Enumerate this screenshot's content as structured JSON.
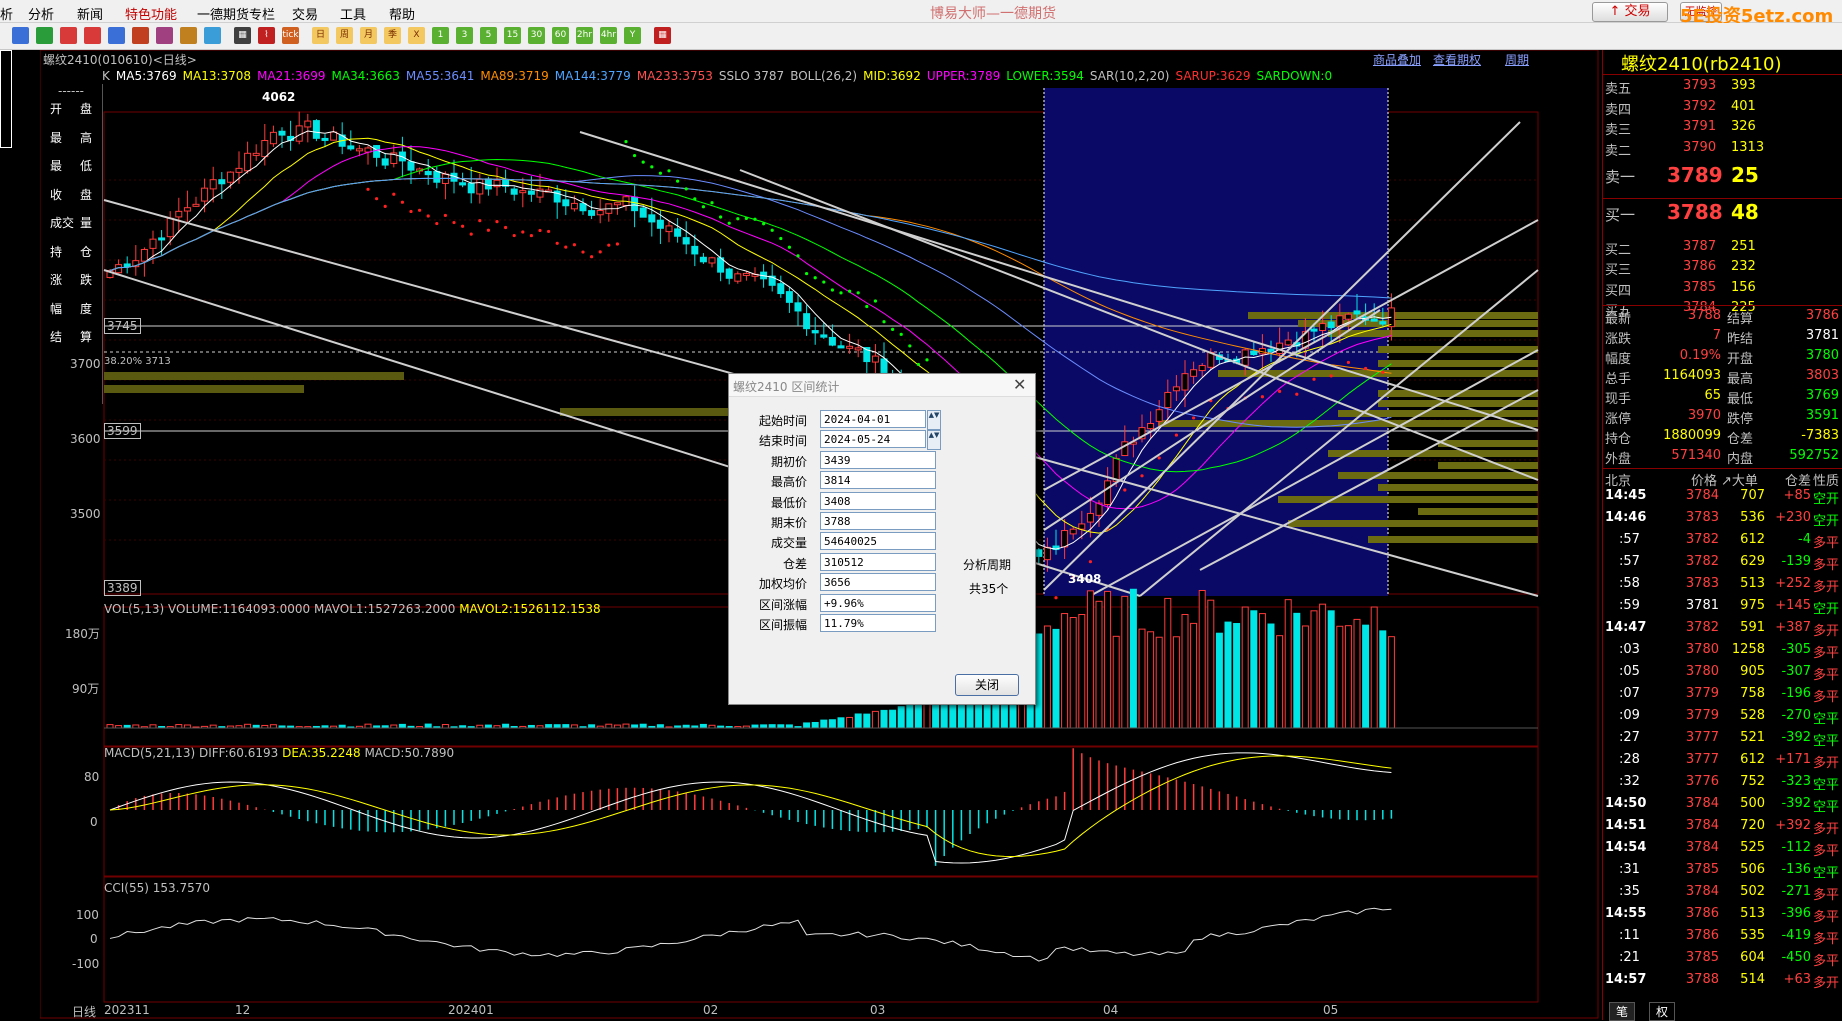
{
  "menu": {
    "items": [
      "析",
      "分析",
      "新闻",
      "特色功能",
      "一德期货专栏",
      "交易",
      "工具",
      "帮助"
    ],
    "app_title": "博易大师—一德期货",
    "trade_button": "交易",
    "stop_button": "无监控",
    "watermark": "5E投资5etz.com"
  },
  "toolbar": {
    "icons": [
      "window-icon",
      "refresh-icon",
      "zoom-in-icon",
      "zoom-out-icon",
      "search-icon",
      "pen-icon",
      "eraser-icon",
      "filter-icon",
      "new-icon",
      "table-icon",
      "chart-icon",
      "tick-icon",
      "day-icon",
      "week-icon",
      "month-icon",
      "season-icon",
      "year-icon",
      "1min-icon",
      "3min-icon",
      "5min-icon",
      "15min-icon",
      "30min-icon",
      "60min-icon",
      "2hr-icon",
      "4hr-icon",
      "y-icon",
      "calc-icon"
    ],
    "labels": [
      "tick",
      "日",
      "周",
      "月",
      "季",
      "X",
      "1",
      "3",
      "5",
      "15",
      "30",
      "60",
      "2hr",
      "4hr",
      "Y"
    ]
  },
  "chart": {
    "title": "螺纹2410(010610)<日线>",
    "top_links": [
      "商品叠加",
      "查看期权",
      "周期"
    ],
    "k_indicators": [
      {
        "text": "K",
        "color": "#c0c0c0"
      },
      {
        "text": "MA5:3769",
        "color": "#ffffff"
      },
      {
        "text": "MA13:3708",
        "color": "#ffff00"
      },
      {
        "text": "MA21:3699",
        "color": "#ff00ff"
      },
      {
        "text": "MA34:3663",
        "color": "#00ff00"
      },
      {
        "text": "MA55:3641",
        "color": "#6a8cff"
      },
      {
        "text": "MA89:3719",
        "color": "#ff8c00"
      },
      {
        "text": "MA144:3779",
        "color": "#4fa4ff"
      },
      {
        "text": "MA233:3753",
        "color": "#ff5050"
      },
      {
        "text": "SSLO 3787",
        "color": "#c0c0c0"
      },
      {
        "text": "BOLL(26,2)",
        "color": "#c0c0c0"
      },
      {
        "text": "MID:3692",
        "color": "#ffff00"
      },
      {
        "text": "UPPER:3789",
        "color": "#ff00ff"
      },
      {
        "text": "LOWER:3594",
        "color": "#00ff00"
      },
      {
        "text": "SAR(10,2,20)",
        "color": "#c0c0c0"
      },
      {
        "text": "SARUP:3629",
        "color": "#ff3030"
      },
      {
        "text": "SARDOWN:0",
        "color": "#00ff00"
      }
    ],
    "price_labels": {
      "high": "4062",
      "low": "3408",
      "fib": "38.20% 3713"
    },
    "boxed_labels": [
      "3745",
      "3599",
      "3389"
    ],
    "y_ticks": [
      "3700",
      "3600",
      "3500"
    ],
    "vol_header": {
      "a": "VOL(5,13)",
      "b": "VOLUME:1164093.0000",
      "c": "MAVOL1:1527263.2000",
      "d": "MAVOL2:1526112.1538"
    },
    "vol_ticks": [
      "180万",
      "90万"
    ],
    "macd_header": {
      "a": "MACD(5,21,13)",
      "b": "DIFF:60.6193",
      "c": "DEA:35.2248",
      "d": "MACD:50.7890"
    },
    "macd_ticks": [
      "80",
      "0"
    ],
    "cci_header": "CCI(55) 153.7570",
    "cci_ticks": [
      "100",
      "0",
      "-100"
    ],
    "x_axis": {
      "period": "日线",
      "labels": [
        "202311",
        "12",
        "202401",
        "02",
        "03",
        "04",
        "05"
      ]
    },
    "left_labels": [
      "------",
      "开",
      "盘",
      "最",
      "高",
      "最",
      "低",
      "收",
      "盘",
      "成交",
      "量",
      "持",
      "仓",
      "涨",
      "跌",
      "幅",
      "度",
      "结",
      "算"
    ]
  },
  "chart_data": {
    "type": "candlestick",
    "x_labels": [
      "202311",
      "12",
      "202401",
      "02",
      "03",
      "04",
      "05"
    ],
    "price_ticks": [
      3700,
      3600,
      3500
    ],
    "annotated_high": 4062,
    "annotated_low": 3408,
    "levels": [
      3745,
      3713,
      3599,
      3389
    ],
    "selected_range": {
      "start": "2024-04-01",
      "end": "2024-05-24"
    }
  },
  "quote": {
    "title": "螺纹2410(rb2410)",
    "asks": [
      {
        "label": "卖五",
        "price": "3793",
        "vol": "393"
      },
      {
        "label": "卖四",
        "price": "3792",
        "vol": "401"
      },
      {
        "label": "卖三",
        "price": "3791",
        "vol": "326"
      },
      {
        "label": "卖二",
        "price": "3790",
        "vol": "1313"
      },
      {
        "label": "卖一",
        "price": "3789",
        "vol": "25"
      }
    ],
    "bids": [
      {
        "label": "买一",
        "price": "3788",
        "vol": "48"
      },
      {
        "label": "买二",
        "price": "3787",
        "vol": "251"
      },
      {
        "label": "买三",
        "price": "3786",
        "vol": "232"
      },
      {
        "label": "买四",
        "price": "3785",
        "vol": "156"
      },
      {
        "label": "买五",
        "price": "3784",
        "vol": "225"
      }
    ],
    "stats": [
      {
        "l1": "最新",
        "v1": "3788",
        "c1": "#ff4040",
        "l2": "结算",
        "v2": "3786",
        "c2": "#ff4040"
      },
      {
        "l1": "涨跌",
        "v1": "7",
        "c1": "#ff4040",
        "l2": "昨结",
        "v2": "3781",
        "c2": "#ffffff"
      },
      {
        "l1": "幅度",
        "v1": "0.19%",
        "c1": "#ff4040",
        "l2": "开盘",
        "v2": "3780",
        "c2": "#00ff00"
      },
      {
        "l1": "总手",
        "v1": "1164093",
        "c1": "#ffff00",
        "l2": "最高",
        "v2": "3803",
        "c2": "#ff4040"
      },
      {
        "l1": "现手",
        "v1": "65",
        "c1": "#ffff00",
        "l2": "最低",
        "v2": "3769",
        "c2": "#00ff00"
      },
      {
        "l1": "涨停",
        "v1": "3970",
        "c1": "#ff4040",
        "l2": "跌停",
        "v2": "3591",
        "c2": "#00ff00"
      },
      {
        "l1": "持仓",
        "v1": "1880099",
        "c1": "#ffff00",
        "l2": "仓差",
        "v2": "-7383",
        "c2": "#ffff00"
      },
      {
        "l1": "外盘",
        "v1": "571340",
        "c1": "#ff4040",
        "l2": "内盘",
        "v2": "592752",
        "c2": "#00ff00"
      }
    ],
    "tick_header": [
      "北京",
      "价格",
      "↗大单",
      "仓差",
      "性质"
    ],
    "ticks": [
      {
        "t": "14:45",
        "p": "3784",
        "v": "707",
        "d": "+85",
        "n": "空开"
      },
      {
        "t": "14:46",
        "p": "3783",
        "v": "536",
        "d": "+230",
        "n": "空开"
      },
      {
        "t": ":57",
        "p": "3782",
        "v": "612",
        "d": "-4",
        "n": "多平"
      },
      {
        "t": ":57",
        "p": "3782",
        "v": "629",
        "d": "-139",
        "n": "多平"
      },
      {
        "t": ":58",
        "p": "3783",
        "v": "513",
        "d": "+252",
        "n": "多开"
      },
      {
        "t": ":59",
        "p": "3781",
        "v": "975",
        "d": "+145",
        "n": "空开"
      },
      {
        "t": "14:47",
        "p": "3782",
        "v": "591",
        "d": "+387",
        "n": "多开"
      },
      {
        "t": ":03",
        "p": "3780",
        "v": "1258",
        "d": "-305",
        "n": "多平"
      },
      {
        "t": ":05",
        "p": "3780",
        "v": "905",
        "d": "-307",
        "n": "多平"
      },
      {
        "t": ":07",
        "p": "3779",
        "v": "758",
        "d": "-196",
        "n": "多平"
      },
      {
        "t": ":09",
        "p": "3779",
        "v": "528",
        "d": "-270",
        "n": "空平"
      },
      {
        "t": ":27",
        "p": "3777",
        "v": "521",
        "d": "-392",
        "n": "空平"
      },
      {
        "t": ":28",
        "p": "3777",
        "v": "612",
        "d": "+171",
        "n": "多开"
      },
      {
        "t": ":32",
        "p": "3776",
        "v": "752",
        "d": "-323",
        "n": "空平"
      },
      {
        "t": "14:50",
        "p": "3784",
        "v": "500",
        "d": "-392",
        "n": "空平"
      },
      {
        "t": "14:51",
        "p": "3784",
        "v": "720",
        "d": "+392",
        "n": "多开"
      },
      {
        "t": "14:54",
        "p": "3784",
        "v": "525",
        "d": "-112",
        "n": "多平"
      },
      {
        "t": ":31",
        "p": "3785",
        "v": "506",
        "d": "-136",
        "n": "空平"
      },
      {
        "t": ":35",
        "p": "3784",
        "v": "502",
        "d": "-271",
        "n": "多平"
      },
      {
        "t": "14:55",
        "p": "3786",
        "v": "513",
        "d": "-396",
        "n": "多平"
      },
      {
        "t": ":11",
        "p": "3786",
        "v": "535",
        "d": "-419",
        "n": "多平"
      },
      {
        "t": ":21",
        "p": "3785",
        "v": "604",
        "d": "-450",
        "n": "多平"
      },
      {
        "t": "14:57",
        "p": "3788",
        "v": "514",
        "d": "+63",
        "n": "多开"
      }
    ],
    "bottom_tabs": [
      "笔",
      "权"
    ]
  },
  "dialog": {
    "title": "螺纹2410 区间统计",
    "fields": [
      {
        "label": "起始时间",
        "value": "2024-04-01"
      },
      {
        "label": "结束时间",
        "value": "2024-05-24"
      },
      {
        "label": "期初价",
        "value": "3439"
      },
      {
        "label": "最高价",
        "value": "3814"
      },
      {
        "label": "最低价",
        "value": "3408"
      },
      {
        "label": "期末价",
        "value": "3788"
      },
      {
        "label": "成交量",
        "value": "54640025"
      },
      {
        "label": "仓差",
        "value": "310512"
      },
      {
        "label": "加权均价",
        "value": "3656"
      },
      {
        "label": "区间涨幅",
        "value": "+9.96%"
      },
      {
        "label": "区间振幅",
        "value": "11.79%"
      }
    ],
    "period_label": "分析周期",
    "period_count": "共35个",
    "close_button": "关闭"
  }
}
